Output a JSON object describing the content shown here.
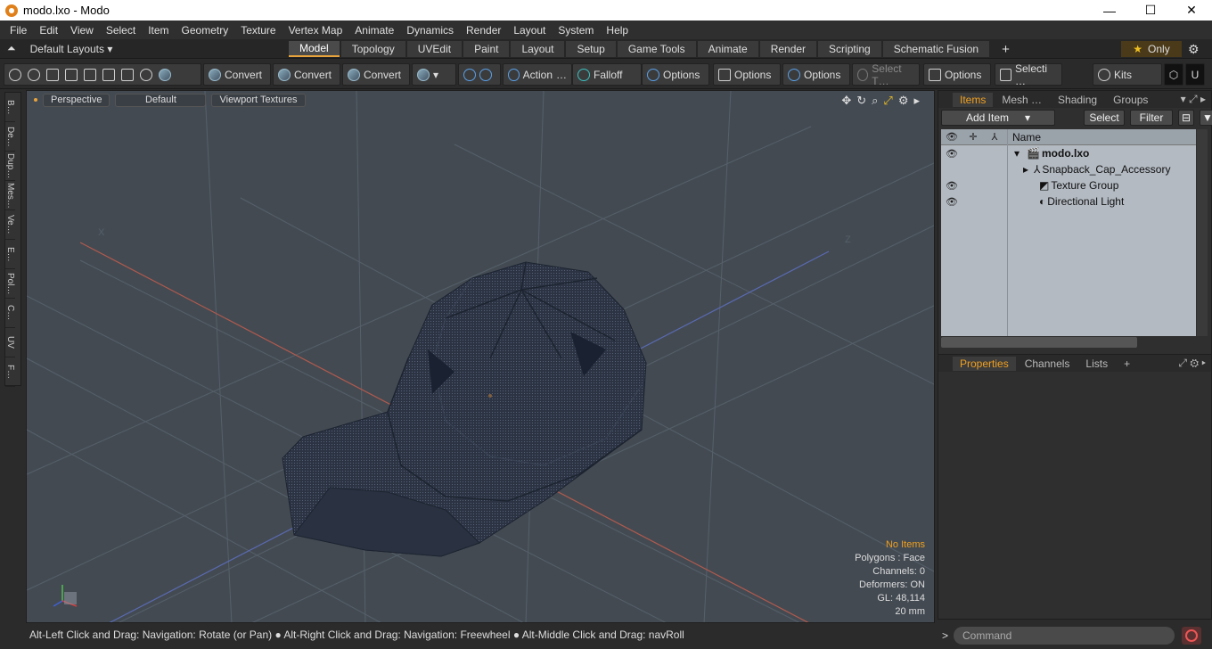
{
  "window": {
    "title": "modo.lxo - Modo",
    "minimize": "—",
    "maximize": "☐",
    "close": "✕"
  },
  "menu": [
    "File",
    "Edit",
    "View",
    "Select",
    "Item",
    "Geometry",
    "Texture",
    "Vertex Map",
    "Animate",
    "Dynamics",
    "Render",
    "Layout",
    "System",
    "Help"
  ],
  "layouts_label": "Default Layouts ▾",
  "mode_tabs": [
    "Model",
    "Topology",
    "UVEdit",
    "Paint",
    "Layout",
    "Setup",
    "Game Tools",
    "Animate",
    "Render",
    "Scripting",
    "Schematic Fusion"
  ],
  "active_mode_tab": "Model",
  "add_tab": "+",
  "only_label": "Only",
  "toolbar": {
    "convert1": "Convert",
    "convert2": "Convert",
    "convert3": "Convert",
    "action": "Action",
    "action_more": "…",
    "falloff": "Falloff",
    "options1": "Options",
    "options2": "Options",
    "options3": "Options",
    "select_t": "Select T…",
    "options4": "Options",
    "selecti": "Selecti …",
    "kits": "Kits"
  },
  "left_strip": [
    "B…",
    "De…",
    "Dup…",
    "Mes…",
    "Ve…",
    "E…",
    "Pol…",
    "C…",
    "UV",
    "F…"
  ],
  "viewport": {
    "view": "Perspective",
    "style": "Default",
    "textures": "Viewport Textures",
    "axis_x": "X",
    "axis_z": "Z",
    "stats": {
      "items": "No Items",
      "polygons": "Polygons : Face",
      "channels": "Channels: 0",
      "deformers": "Deformers: ON",
      "gl": "GL: 48,114",
      "scale": "20 mm"
    }
  },
  "status_bar": "Alt-Left Click and Drag: Navigation: Rotate (or Pan) ● Alt-Right Click and Drag: Navigation: Freewheel ● Alt-Middle Click and Drag: navRoll",
  "items_panel": {
    "tabs": [
      "Items",
      "Mesh …",
      "Shading",
      "Groups"
    ],
    "active_tab": "Items",
    "add_item": "Add Item",
    "select": "Select",
    "filter": "Filter",
    "name_header": "Name",
    "rows": [
      "modo.lxo",
      "Snapback_Cap_Accessory",
      "Texture Group",
      "Directional Light"
    ]
  },
  "properties_panel": {
    "tabs": [
      "Properties",
      "Channels",
      "Lists"
    ],
    "active_tab": "Properties",
    "add": "+"
  },
  "command_placeholder": "Command",
  "colors": {
    "accent": "#e8a33c",
    "viewport_bg": "#434a52",
    "list_bg": "#b3bac2"
  }
}
